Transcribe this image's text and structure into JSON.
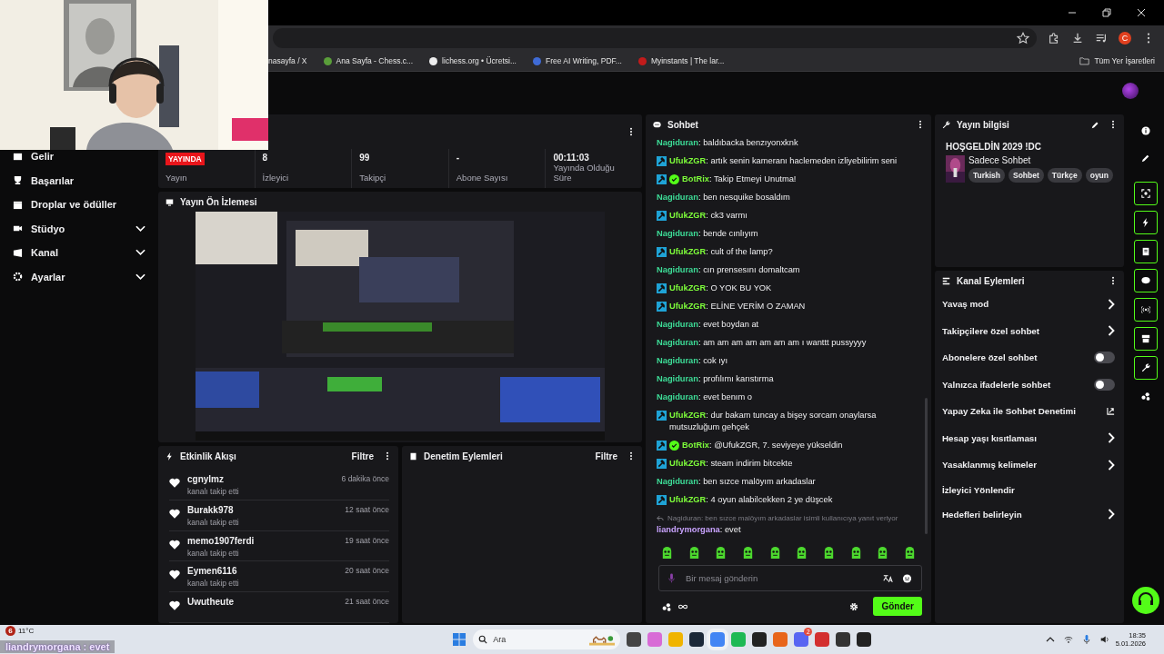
{
  "browser": {
    "bookmarks": [
      "nasayfa / X",
      "Ana Sayfa - Chess.c...",
      "lichess.org • Ücretsi...",
      "Free AI Writing, PDF...",
      "Myinstants | The lar..."
    ],
    "bookmark_folder": "Tüm Yer İşaretleri",
    "profile_initial": "C"
  },
  "sidebar": {
    "items": [
      {
        "label": "Gelir",
        "expandable": false
      },
      {
        "label": "Başarılar",
        "expandable": false
      },
      {
        "label": "Droplar ve ödüller",
        "expandable": false
      },
      {
        "label": "Stüdyo",
        "expandable": true
      },
      {
        "label": "Kanal",
        "expandable": true
      },
      {
        "label": "Ayarlar",
        "expandable": true
      }
    ]
  },
  "stream_stats": [
    {
      "kind": "badge",
      "value": "YAYINDA",
      "label": "Yayın"
    },
    {
      "kind": "text",
      "value": "8",
      "label": "İzleyici"
    },
    {
      "kind": "text",
      "value": "99",
      "label": "Takipçi"
    },
    {
      "kind": "text",
      "value": "-",
      "label": "Abone Sayısı"
    },
    {
      "kind": "text",
      "value": "00:11:03",
      "label": "Yayında Olduğu Süre"
    }
  ],
  "preview": {
    "title": "Yayın Ön İzlemesi"
  },
  "activity": {
    "title": "Etkinlik Akışı",
    "filter": "Filtre",
    "events": [
      {
        "user": "cgnylmz",
        "action": "kanalı takip etti",
        "time": "6 dakika önce"
      },
      {
        "user": "Burakk978",
        "action": "kanalı takip etti",
        "time": "12 saat önce"
      },
      {
        "user": "memo1907ferdi",
        "action": "kanalı takip etti",
        "time": "19 saat önce"
      },
      {
        "user": "Eymen6116",
        "action": "kanalı takip etti",
        "time": "20 saat önce"
      },
      {
        "user": "Uwutheute",
        "time": "21 saat önce"
      }
    ]
  },
  "moderation": {
    "title": "Denetim Eylemleri",
    "filter": "Filtre"
  },
  "chat": {
    "title": "Sohbet",
    "messages": [
      {
        "user": "Nagiduran",
        "color": "#3ddc97",
        "mod": false,
        "verified": false,
        "text": ": baldıbacka benzıyonxknk"
      },
      {
        "user": "UfukZGR",
        "color": "#7dfc3a",
        "mod": true,
        "verified": false,
        "text": ": artık senin kameranı haclemeden izliyebilirim seni"
      },
      {
        "user": "BotRix",
        "color": "#7dfc3a",
        "mod": true,
        "verified": true,
        "text": ": Takip Etmeyi Unutma!"
      },
      {
        "user": "Nagiduran",
        "color": "#3ddc97",
        "mod": false,
        "verified": false,
        "text": ": ben nesquike bosaldım"
      },
      {
        "user": "UfukZGR",
        "color": "#7dfc3a",
        "mod": true,
        "verified": false,
        "text": ": ck3 varmı"
      },
      {
        "user": "Nagiduran",
        "color": "#3ddc97",
        "mod": false,
        "verified": false,
        "text": ": bende cınlıyım"
      },
      {
        "user": "UfukZGR",
        "color": "#7dfc3a",
        "mod": true,
        "verified": false,
        "text": ": cult of the lamp?"
      },
      {
        "user": "Nagiduran",
        "color": "#3ddc97",
        "mod": false,
        "verified": false,
        "text": ": cın prensesını domaltcam"
      },
      {
        "user": "UfukZGR",
        "color": "#7dfc3a",
        "mod": true,
        "verified": false,
        "text": ": O YOK BU YOK"
      },
      {
        "user": "UfukZGR",
        "color": "#7dfc3a",
        "mod": true,
        "verified": false,
        "text": ": ELİNE VERİM O ZAMAN"
      },
      {
        "user": "Nagiduran",
        "color": "#3ddc97",
        "mod": false,
        "verified": false,
        "text": ": evet boydan at"
      },
      {
        "user": "Nagiduran",
        "color": "#3ddc97",
        "mod": false,
        "verified": false,
        "text": ": am am am am am am am ı wanttt pussyyyy"
      },
      {
        "user": "Nagiduran",
        "color": "#3ddc97",
        "mod": false,
        "verified": false,
        "text": ": cok ıyı"
      },
      {
        "user": "Nagiduran",
        "color": "#3ddc97",
        "mod": false,
        "verified": false,
        "text": ": profılımı karıstırma"
      },
      {
        "user": "Nagiduran",
        "color": "#3ddc97",
        "mod": false,
        "verified": false,
        "text": ": evet benım o"
      },
      {
        "user": "UfukZGR",
        "color": "#7dfc3a",
        "mod": true,
        "verified": false,
        "text": ": dur bakam tuncay a bişey sorcam onaylarsa mutsuzluğum gehçek"
      },
      {
        "user": "BotRix",
        "color": "#7dfc3a",
        "mod": true,
        "verified": true,
        "text": ": @UfukZGR, 7. seviyeye yükseldin"
      },
      {
        "user": "UfukZGR",
        "color": "#7dfc3a",
        "mod": true,
        "verified": false,
        "text": ": steam indirim bitcekte"
      },
      {
        "user": "Nagiduran",
        "color": "#3ddc97",
        "mod": false,
        "verified": false,
        "text": ": ben sızce malöyım arkadaslar"
      },
      {
        "user": "UfukZGR",
        "color": "#7dfc3a",
        "mod": true,
        "verified": false,
        "text": ": 4 oyun alabilcekken 2 ye düşcek"
      },
      {
        "user": "liandrymorgana",
        "color": "#c9a3ff",
        "mod": false,
        "verified": false,
        "reply": "Nagiduran: ben sızce malöyım arkadaslar isimli kullanıcıya yanıt veriyor",
        "text": ": evet"
      }
    ],
    "placeholder": "Bir mesaj gönderin",
    "send": "Gönder"
  },
  "stream_info": {
    "title": "Yayın bilgisi",
    "stream_title": "HOŞGELDİN 2029 !DC",
    "category": "Sadece Sohbet",
    "tags": [
      "Turkish",
      "Sohbet",
      "Türkçe",
      "oyun"
    ]
  },
  "channel_actions": {
    "title": "Kanal Eylemleri",
    "items": [
      {
        "kind": "chevron",
        "label": "Yavaş mod"
      },
      {
        "kind": "chevron",
        "label": "Takipçilere özel sohbet"
      },
      {
        "kind": "toggle",
        "label": "Abonelere özel sohbet",
        "on": false
      },
      {
        "kind": "toggle",
        "label": "Yalnızca ifadelerle sohbet",
        "on": false
      },
      {
        "kind": "external",
        "label": "Yapay Zeka ile Sohbet Denetimi"
      },
      {
        "kind": "chevron",
        "label": "Hesap yaşı kısıtlaması"
      },
      {
        "kind": "chevron",
        "label": "Yasaklanmış kelimeler"
      },
      {
        "kind": "plain",
        "label": "İzleyici Yönlendir"
      },
      {
        "kind": "chevron",
        "label": "Hedefleri belirleyin"
      }
    ]
  },
  "taskbar": {
    "weather": "11°C",
    "weather_badge": "6",
    "search_placeholder": "Ara",
    "discord_badge": "2",
    "time": "18:35",
    "date": "5.01.2026"
  },
  "caption": "liandrymorgana : evet"
}
